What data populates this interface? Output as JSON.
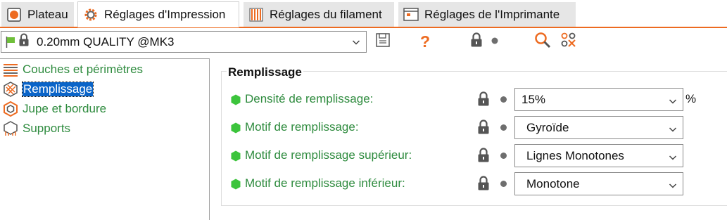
{
  "tabs": [
    {
      "label": "Plateau",
      "icon": "plater-icon",
      "active": false
    },
    {
      "label": "Réglages d'Impression",
      "icon": "gear-icon",
      "active": true
    },
    {
      "label": "Réglages du filament",
      "icon": "filament-spool-icon",
      "active": false
    },
    {
      "label": "Réglages de l'Imprimante",
      "icon": "printer-icon",
      "active": false
    }
  ],
  "preset": {
    "value": "0.20mm QUALITY @MK3",
    "icons": [
      "green-flag-icon",
      "lock-icon",
      "chevron-down-icon"
    ]
  },
  "toolbar": {
    "help_label": "?",
    "icons": [
      "save-icon",
      "question-mark-icon",
      "lock-icon",
      "dot-icon",
      "search-icon",
      "compare-icon"
    ]
  },
  "sidebar": {
    "items": [
      {
        "label": "Couches et périmètres",
        "icon": "layers-icon",
        "selected": false
      },
      {
        "label": "Remplissage",
        "icon": "infill-icon",
        "selected": true
      },
      {
        "label": "Jupe et bordure",
        "icon": "skirt-brim-icon",
        "selected": false
      },
      {
        "label": "Supports",
        "icon": "supports-icon",
        "selected": false
      }
    ]
  },
  "main": {
    "group_title": "Remplissage",
    "rows": [
      {
        "label": "Densité de remplissage:",
        "value": "15%",
        "unit": "%"
      },
      {
        "label": "Motif de remplissage:",
        "value": "Gyroïde",
        "unit": ""
      },
      {
        "label": "Motif de remplissage supérieur:",
        "value": "Lignes Monotones",
        "unit": ""
      },
      {
        "label": "Motif de remplissage inférieur:",
        "value": "Monotone",
        "unit": ""
      }
    ]
  },
  "colors": {
    "accent": "#ed6b21",
    "label_green": "#2e8b3e",
    "selection_blue": "#0a64c8",
    "hex_green": "#3cc43c"
  }
}
